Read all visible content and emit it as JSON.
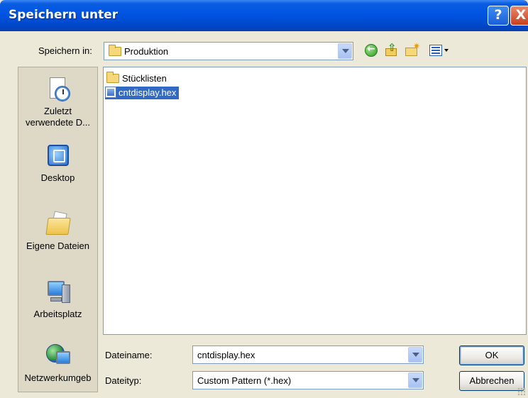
{
  "window": {
    "title": "Speichern unter",
    "help_label": "?",
    "close_label": "X"
  },
  "location": {
    "label": "Speichern in:",
    "value": "Produktion"
  },
  "toolbar": {
    "back_icon": "back-arrow-icon",
    "up_icon": "up-folder-icon",
    "new_folder_icon": "new-folder-icon",
    "views_icon": "views-menu-icon"
  },
  "places": [
    {
      "label": "Zuletzt verwendete D...",
      "icon": "recent-documents-icon"
    },
    {
      "label": "Desktop",
      "icon": "desktop-icon"
    },
    {
      "label": "Eigene Dateien",
      "icon": "my-documents-icon"
    },
    {
      "label": "Arbeitsplatz",
      "icon": "my-computer-icon"
    },
    {
      "label": "Netzwerkumgeb",
      "icon": "network-places-icon"
    }
  ],
  "files": [
    {
      "name": "Stücklisten",
      "type": "folder",
      "selected": false
    },
    {
      "name": "cntdisplay.hex",
      "type": "file",
      "selected": true
    }
  ],
  "filename": {
    "label": "Dateiname:",
    "value": "cntdisplay.hex"
  },
  "filetype": {
    "label": "Dateityp:",
    "value": "Custom Pattern (*.hex)"
  },
  "buttons": {
    "ok": "OK",
    "cancel": "Abbrechen"
  },
  "colors": {
    "titlebar": "#0054e3",
    "selection": "#316ac5",
    "dialog_bg": "#ece9d8"
  }
}
